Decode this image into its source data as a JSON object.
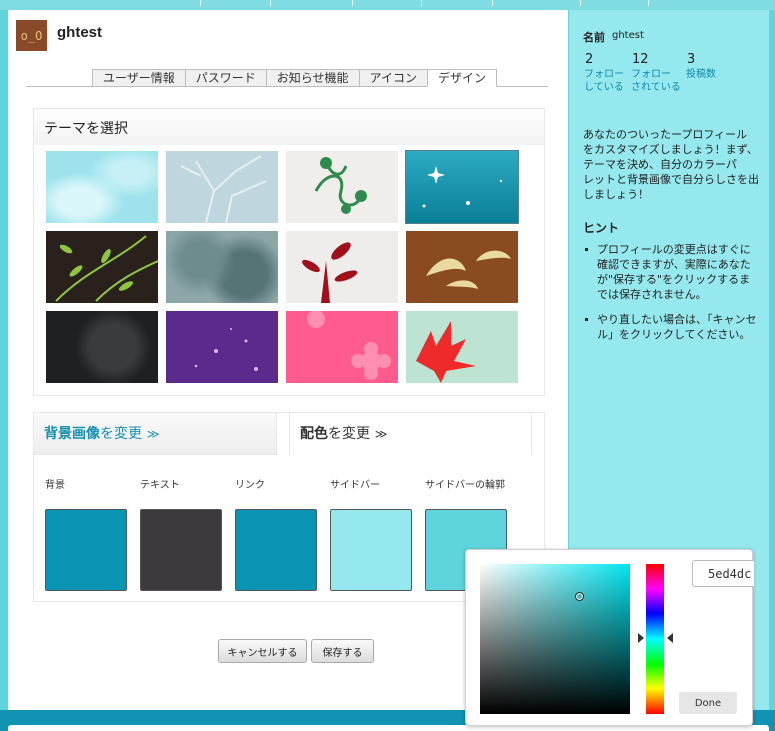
{
  "header": {
    "avatar_text": "o_O",
    "username": "ghtest"
  },
  "tabs": [
    {
      "label": "ユーザー情報"
    },
    {
      "label": "パスワード"
    },
    {
      "label": "お知らせ機能"
    },
    {
      "label": "アイコン"
    },
    {
      "label": "デザイン",
      "active": true
    }
  ],
  "theme": {
    "heading": "テーマを選択",
    "thumbnails": [
      "theme-clouds",
      "theme-bare-tree",
      "theme-vines",
      "theme-sparkle-blue",
      "theme-green-leaves",
      "theme-foliage-grey",
      "theme-red-plant",
      "theme-birds-brown",
      "theme-dark-trees",
      "theme-purple-stars",
      "theme-pink-flowers",
      "theme-red-maple"
    ]
  },
  "design": {
    "bg_tab": {
      "emph": "背景画像",
      "rest": "を変更",
      "chev": "≫"
    },
    "color_tab": {
      "emph": "配色",
      "rest": "を変更",
      "chev": "≫"
    },
    "swatches": [
      {
        "label": "背景",
        "color": "#0a94b4"
      },
      {
        "label": "テキスト",
        "color": "#3c3a3f"
      },
      {
        "label": "リンク",
        "color": "#0a94b4"
      },
      {
        "label": "サイドバー",
        "color": "#95e8ee"
      },
      {
        "label": "サイドバーの輪郭",
        "color": "#5ed4dc"
      }
    ]
  },
  "buttons": {
    "cancel": "キャンセルする",
    "save": "保存する"
  },
  "sidebar": {
    "name_label": "名前",
    "name_value": "ghtest",
    "stats": [
      {
        "num": "2",
        "line1": "フォロー",
        "line2": "している"
      },
      {
        "num": "12",
        "line1": "フォロー",
        "line2": "されている"
      },
      {
        "num": "3",
        "line1": "投稿数",
        "line2": ""
      }
    ],
    "intro_lines": [
      "あなたのついったープロフィール",
      "をカスタマイズしましょう！まず、",
      "テーマを決め、自分のカラーパ",
      "レットと背景画像で自分らしさを出",
      "しましょう！"
    ],
    "hint_title": "ヒント",
    "hints": [
      [
        "プロフィールの変更点はすぐに",
        "確認できますが、実際にあなた",
        "が\"保存する\"をクリックするま",
        "では保存されません。"
      ],
      [
        "やり直したい場合は、「キャンセ",
        "ル」をクリックしてください。"
      ]
    ]
  },
  "picker": {
    "hex_value": "5ed4dc",
    "done_label": "Done"
  }
}
